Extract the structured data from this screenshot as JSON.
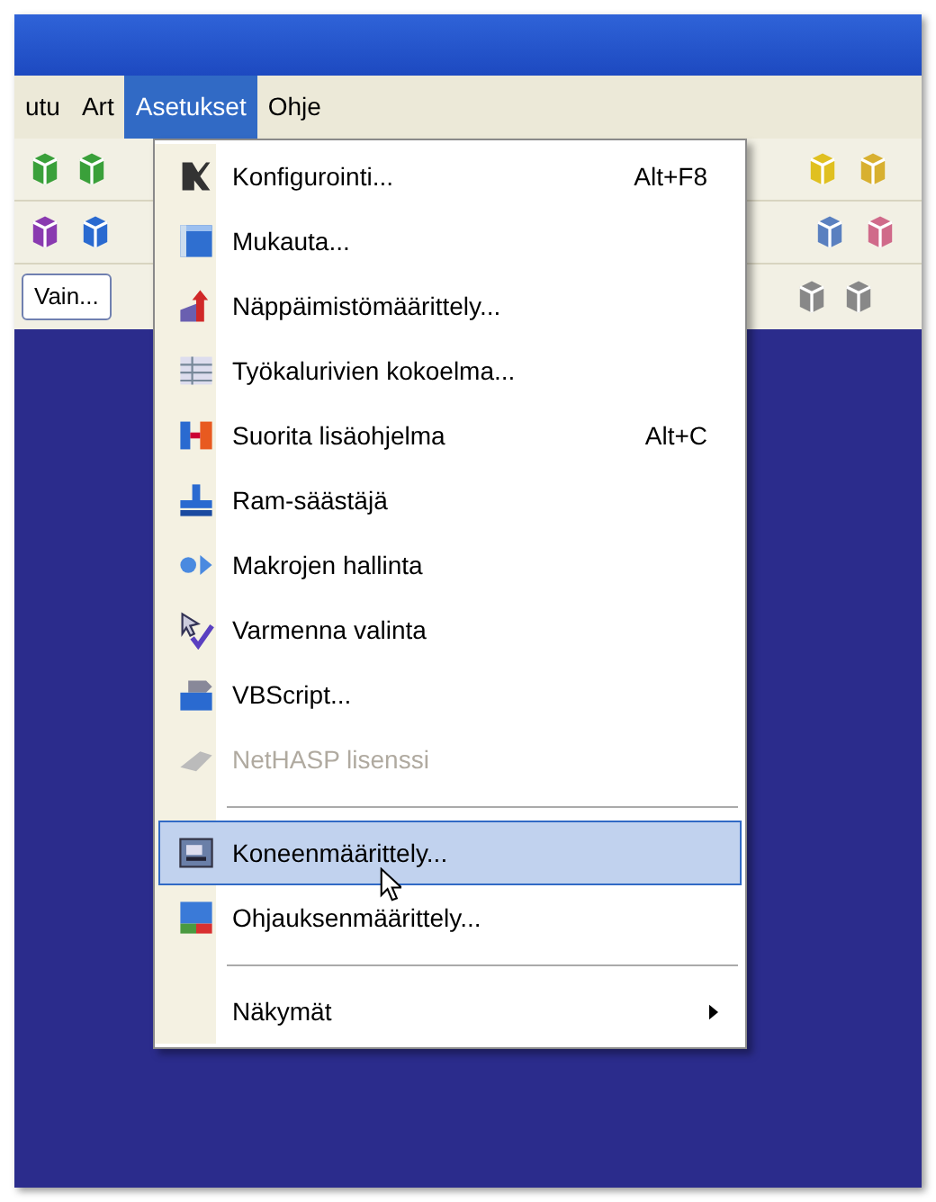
{
  "menubar": [
    {
      "label": "utu",
      "selected": false
    },
    {
      "label": "Art",
      "selected": false
    },
    {
      "label": "Asetukset",
      "selected": true
    },
    {
      "label": "Ohje",
      "selected": false
    }
  ],
  "toolbar": {
    "button": "Vain..."
  },
  "menu": [
    {
      "kind": "item",
      "label": "Konfigurointi...",
      "shortcut": "Alt+F8",
      "disabled": false,
      "selected": false
    },
    {
      "kind": "item",
      "label": "Mukauta...",
      "disabled": false,
      "selected": false
    },
    {
      "kind": "item",
      "label": "Näppäimistömäärittely...",
      "disabled": false,
      "selected": false
    },
    {
      "kind": "item",
      "label": "Työkalurivien kokoelma...",
      "disabled": false,
      "selected": false
    },
    {
      "kind": "item",
      "label": "Suorita lisäohjelma",
      "shortcut": "Alt+C",
      "disabled": false,
      "selected": false
    },
    {
      "kind": "item",
      "label": "Ram-säästäjä",
      "disabled": false,
      "selected": false
    },
    {
      "kind": "item",
      "label": "Makrojen hallinta",
      "disabled": false,
      "selected": false
    },
    {
      "kind": "item",
      "label": "Varmenna valinta",
      "disabled": false,
      "selected": false
    },
    {
      "kind": "item",
      "label": "VBScript...",
      "disabled": false,
      "selected": false
    },
    {
      "kind": "item",
      "label": "NetHASP lisenssi",
      "disabled": true,
      "selected": false
    },
    {
      "kind": "separator"
    },
    {
      "kind": "item",
      "label": "Koneenmäärittely...",
      "disabled": false,
      "selected": true
    },
    {
      "kind": "item",
      "label": "Ohjauksenmäärittely...",
      "disabled": false,
      "selected": false
    },
    {
      "kind": "separator"
    },
    {
      "kind": "submenu",
      "label": "Näkymät",
      "disabled": false,
      "selected": false
    }
  ]
}
